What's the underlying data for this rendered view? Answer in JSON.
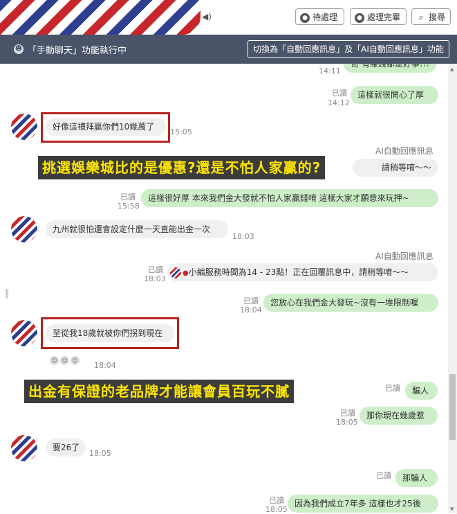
{
  "header": {
    "speaker_icon": "speaker-icon",
    "pending_label": "待處理",
    "done_label": "處理完畢",
    "search_label": "搜尋"
  },
  "status_bar": {
    "text": "「手動聊天」功能執行中",
    "switch_label": "切換為「自動回應訊息」及「AI自動回應訊息」功能"
  },
  "messages": {
    "m1": {
      "text": "哥 有賺錢都是好事!!!",
      "time": "14:11"
    },
    "m2": {
      "text": "這樣就很開心了厚",
      "read": "已讀",
      "time": "14:12"
    },
    "m3": {
      "text": "好像這禮拜贏你們10幾萬了",
      "time": "15:05"
    },
    "m4": {
      "ai_label": "AI自動回應訊息",
      "text": "請稍等唷～～"
    },
    "m5": {
      "text": "這樣很好厚  本來我們金大發就不怕人家贏錢唷 這樣大家才願意來玩押~",
      "read": "已讀",
      "time": "15:58"
    },
    "m6": {
      "text": "九州就很怕還會設定什麼一天直能出金一次",
      "time": "18:03"
    },
    "m7": {
      "ai_label": "AI自動回應訊息",
      "text": "小編服務時間為14 - 23點！正在回覆訊息中，請稍等唷～～",
      "read": "已讀",
      "time": "18:03"
    },
    "m8": {
      "text": "您放心在我們金大發玩~沒有一堆限制喔",
      "read": "已讀",
      "time": "18:04"
    },
    "m9": {
      "text": "至從我18歲就被你們拐到現在"
    },
    "m10": {
      "time": "18:04"
    },
    "m11": {
      "text": "騙人",
      "read": "已讀"
    },
    "m12": {
      "text": "那你現在幾歲惹",
      "read": "已讀",
      "time": "18:05"
    },
    "m13": {
      "text": "要26了",
      "time": "18:05"
    },
    "m14": {
      "text": "那騙人",
      "read": "已讀"
    },
    "m15": {
      "text": "因為我們成立7年多 這樣也才25後",
      "read": "已讀",
      "time": "18:05"
    }
  },
  "captions": {
    "c1": "挑選娛樂城比的是優惠?還是不怕人家贏的?",
    "c2": "出金有保證的老品牌才能讓會員百玩不膩"
  },
  "colors": {
    "status_bar": "#4a5468",
    "outgoing_bubble": "#cdeec9",
    "incoming_bubble": "#f0f0f0",
    "highlight_box": "#b5251d",
    "caption_text": "#ffe600"
  }
}
